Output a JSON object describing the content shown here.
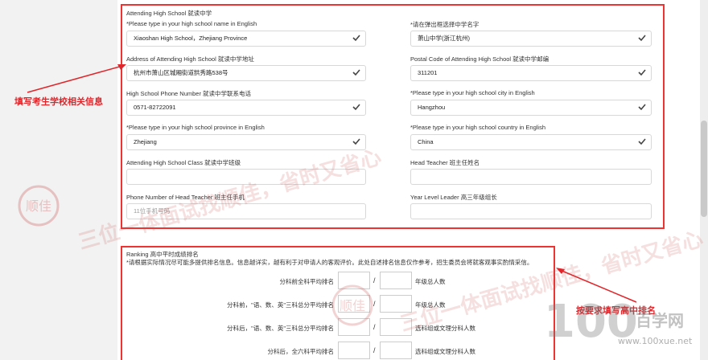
{
  "school": {
    "section_title": "Attending High School  就读中学",
    "fields": [
      {
        "label": "*Please type in your high school name in English",
        "value": "Xiaoshan High School，Zhejiang Province",
        "checked": true
      },
      {
        "label": "*请在弹出框选择中学名字",
        "value": "萧山中学(浙江杭州)",
        "checked": true
      },
      {
        "label": "Address of Attending High School  就读中学地址",
        "value": "杭州市萧山区城厢街道拱秀路538号",
        "checked": true
      },
      {
        "label": "Postal Code of Attending High School  就读中学邮编",
        "value": "311201",
        "checked": true
      },
      {
        "label": "High School Phone Number  就读中学联系电话",
        "value": "0571-82722091",
        "checked": true
      },
      {
        "label": "*Please type in your high school city in English",
        "value": "Hangzhou",
        "checked": true
      },
      {
        "label": "*Please type in your high school province in English",
        "value": "Zhejiang",
        "checked": true
      },
      {
        "label": "*Please type in your high school country in English",
        "value": "China",
        "checked": true
      },
      {
        "label": "Attending High School Class  就读中学班级",
        "value": "",
        "checked": false
      },
      {
        "label": "Head Teacher  班主任姓名",
        "value": "",
        "checked": false
      },
      {
        "label": "Phone Number of Head Teacher  班主任手机",
        "placeholder": "11位手机号码",
        "checked": false
      },
      {
        "label": "Year Level Leader  高三年级组长",
        "value": "",
        "checked": false
      }
    ]
  },
  "ranking": {
    "title": "Ranking  高中平时成绩排名",
    "note": "*请根据实际情况尽可能多提供排名信息。信息越详实，越有利于对申请人的客观评价。此处自述排名信息仅作参考，招生委员会将就客观事实酌情采信。",
    "rows": [
      {
        "label": "分科前全科平均排名",
        "tail": "年级总人数"
      },
      {
        "label": "分科前，\"语、数、英\"三科总分平均排名",
        "tail": "年级总人数"
      },
      {
        "label": "分科后，\"语、数、英\"三科总分平均排名",
        "tail": "选科组或文理分科人数"
      },
      {
        "label": "分科后，全六科平均排名",
        "tail": "选科组或文理分科人数"
      }
    ],
    "slash": "/"
  },
  "annotations": {
    "left": "填写考生学校相关信息",
    "right": "按要求填写高中排名"
  },
  "watermark": {
    "logo_char": "顺佳",
    "slogan1": "三位一体面试找顺佳，省时又省心",
    "slogan2": "三位一体面试找顺佳，省时又省心",
    "brand": "百学网",
    "url": "www.100xue.net",
    "brand_num": "100"
  },
  "colors": {
    "accent": "#e0262b",
    "check": "#444444"
  }
}
